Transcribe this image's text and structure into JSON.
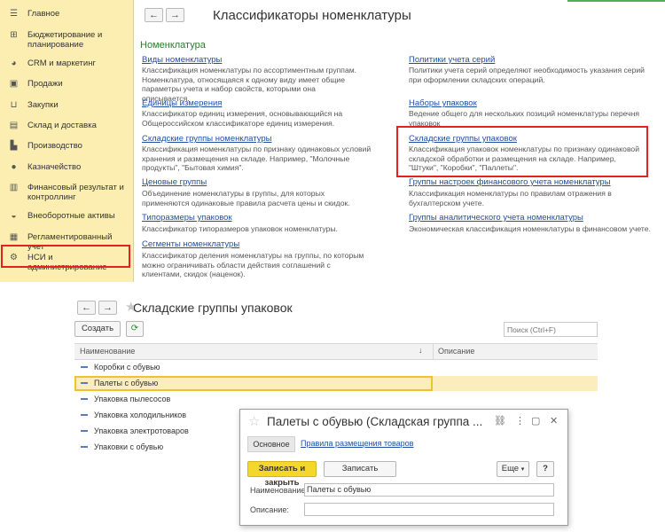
{
  "sidebar": {
    "items": [
      {
        "label": "Главное",
        "icon": "menu-lines-icon"
      },
      {
        "label": "Бюджетирование и планирование",
        "icon": "budget-icon"
      },
      {
        "label": "CRM и маркетинг",
        "icon": "pie-chart-icon"
      },
      {
        "label": "Продажи",
        "icon": "shopping-bag-icon"
      },
      {
        "label": "Закупки",
        "icon": "cart-icon"
      },
      {
        "label": "Склад и доставка",
        "icon": "warehouse-icon"
      },
      {
        "label": "Производство",
        "icon": "factory-icon"
      },
      {
        "label": "Казначейство",
        "icon": "coin-icon"
      },
      {
        "label": "Финансовый результат и контроллинг",
        "icon": "bar-chart-icon"
      },
      {
        "label": "Внеоборотные активы",
        "icon": "car-icon"
      },
      {
        "label": "Регламентированный учет",
        "icon": "ledger-icon"
      },
      {
        "label": "НСИ и администрирование",
        "icon": "gear-icon"
      }
    ]
  },
  "top": {
    "title": "Классификаторы номенклатуры",
    "section": "Номенклатура",
    "left_col": [
      {
        "link": "Виды номенклатуры",
        "desc": "Классификация номенклатуры по ассортиментным группам. Номенклатура, относящаяся к одному виду имеет общие параметры учета и набор свойств, которыми она описывается."
      },
      {
        "link": "Единицы измерения",
        "desc": "Классификатор единиц измерения, основывающийся на Общероссийском классификаторе единиц измерения."
      },
      {
        "link": "Складские группы номенклатуры",
        "desc": "Классификация номенклатуры по признаку одинаковых условий хранения и размещения на складе. Например, \"Молочные продукты\", \"Бытовая химия\"."
      },
      {
        "link": "Ценовые группы",
        "desc": "Объединение номенклатуры в группы, для которых применяются одинаковые правила расчета цены и скидок."
      },
      {
        "link": "Типоразмеры упаковок",
        "desc": "Классификатор типоразмеров упаковок номенклатуры."
      },
      {
        "link": "Сегменты номенклатуры",
        "desc": "Классификатор деления номенклатуры на группы, по которым можно ограничивать области действия соглашений с клиентами, скидок (наценок)."
      }
    ],
    "right_col": [
      {
        "link": "Политики учета серий",
        "desc": "Политики учета серий определяют необходимость указания серий при оформлении складских операций."
      },
      {
        "link": "Наборы упаковок",
        "desc": "Ведение общего для нескольких позиций номенклатуры перечня упаковок"
      },
      {
        "link": "Складские группы упаковок",
        "desc": "Классификация упаковок номенклатуры по признаку одинаковой складской обработки и размещения на складе. Например, \"Штуки\", \"Коробки\", \"Паллеты\"."
      },
      {
        "link": "Группы настроек финансового учета номенклатуры",
        "desc": "Классификация номенклатуры по правилам отражения в бухгалтерском учете."
      },
      {
        "link": "Группы аналитического учета номенклатуры",
        "desc": "Экономическая классификация номенклатуры в финансовом учете."
      }
    ]
  },
  "list": {
    "title": "Складские группы упаковок",
    "create_label": "Создать",
    "search_placeholder": "Поиск (Ctrl+F)",
    "col_name": "Наименование",
    "col_desc": "Описание",
    "sort_arrow": "↓",
    "rows": [
      "Коробки с обувью",
      "Палеты с обувью",
      "Упаковка пылесосов",
      "Упаковка холодильников",
      "Упаковка электротоваров",
      "Упаковки с обувью"
    ],
    "selected_index": 1
  },
  "dialog": {
    "title": "Палеты с обувью (Складская группа ...",
    "tab_main": "Основное",
    "tab_rules": "Правила размещения товаров",
    "save_close": "Записать и закрыть",
    "save": "Записать",
    "more": "Еще",
    "help": "?",
    "name_label": "Наименование:",
    "name_value": "Палеты с обувью",
    "desc_label": "Описание:",
    "desc_value": ""
  },
  "colors": {
    "sidebar_bg": "#fbeeb0",
    "link": "#1f4fa3",
    "section": "#2b7a2b",
    "highlight_red": "#e32121",
    "primary_button": "#f3d82b",
    "selected_row": "#fbeebc"
  }
}
